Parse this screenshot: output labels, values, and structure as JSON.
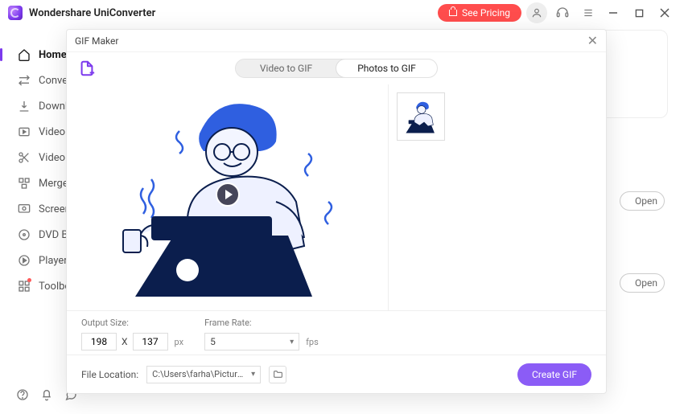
{
  "app": {
    "title": "Wondershare UniConverter",
    "see_pricing": "See Pricing"
  },
  "sidebar": {
    "items": [
      {
        "label": "Home"
      },
      {
        "label": "Converter"
      },
      {
        "label": "Downloader"
      },
      {
        "label": "Video Compressor"
      },
      {
        "label": "Video Editor"
      },
      {
        "label": "Merger"
      },
      {
        "label": "Screen Recorder"
      },
      {
        "label": "DVD Burner"
      },
      {
        "label": "Player"
      },
      {
        "label": "Toolbox"
      }
    ]
  },
  "bg": {
    "open_label": "Open"
  },
  "modal": {
    "title": "GIF Maker",
    "tabs": {
      "video": "Video to GIF",
      "photos": "Photos to GIF"
    },
    "output_size_label": "Output Size:",
    "width": "198",
    "height": "137",
    "x": "X",
    "px": "px",
    "frame_rate_label": "Frame Rate:",
    "frame_rate_value": "5",
    "fps": "fps",
    "file_location_label": "File Location:",
    "file_location_value": "C:\\Users\\farha\\Pictures\\Wonder",
    "create_label": "Create GIF"
  }
}
